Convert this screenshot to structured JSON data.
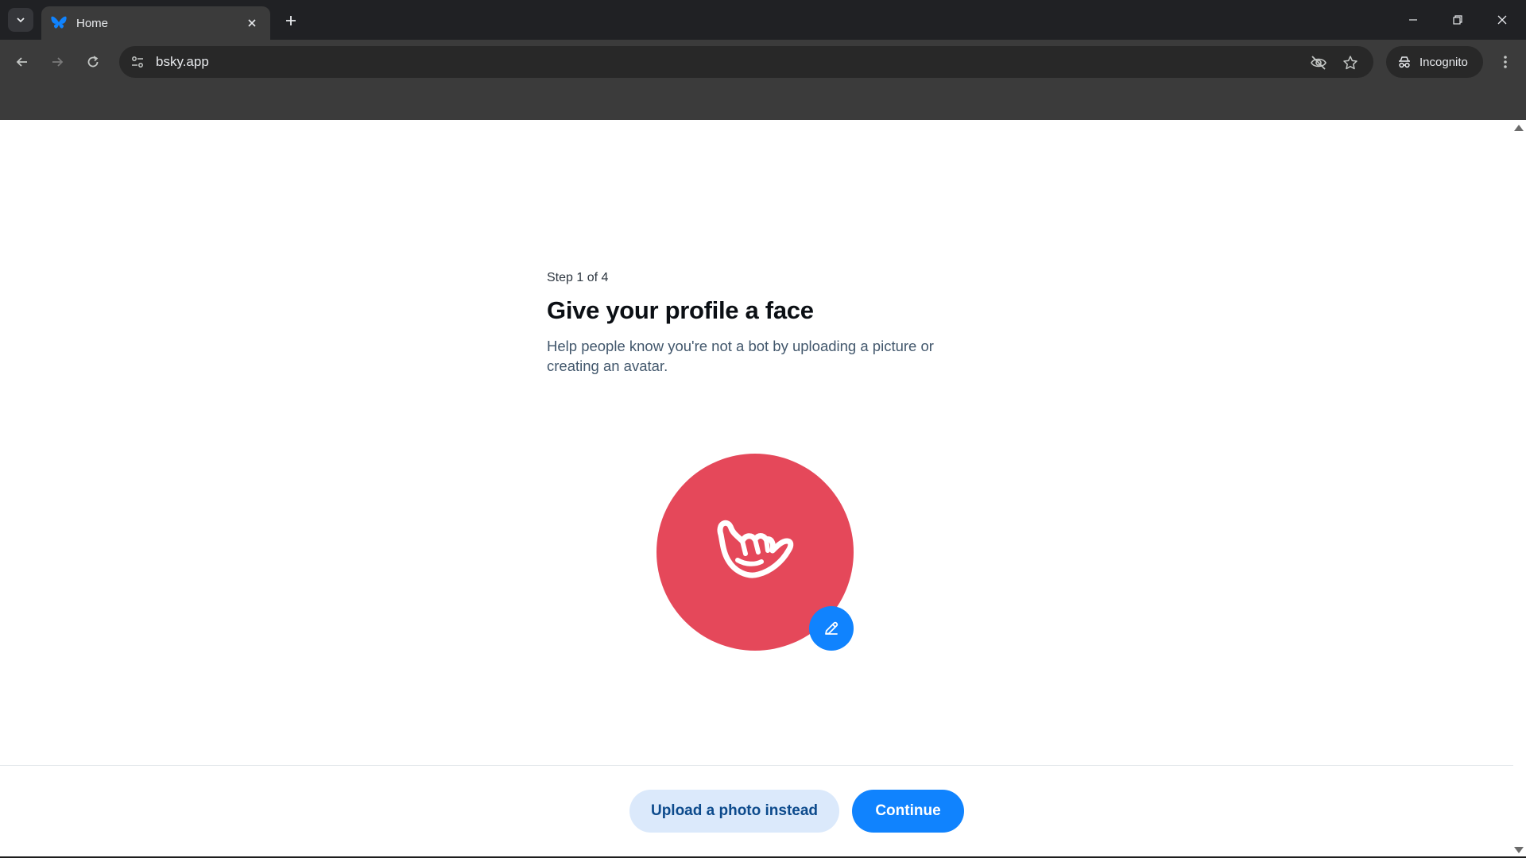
{
  "browser": {
    "tab": {
      "title": "Home",
      "favicon": "bluesky-butterfly-icon"
    },
    "address": {
      "url": "bsky.app"
    },
    "incognito_label": "Incognito"
  },
  "onboarding": {
    "step_label": "Step 1 of 4",
    "title": "Give your profile a face",
    "description": "Help people know you're not a bot by uploading a picture or creating an avatar.",
    "avatar": {
      "background": "#e5485a",
      "icon": "shaka-hand-icon"
    },
    "edit_button_icon": "pencil-icon"
  },
  "footer": {
    "upload_label": "Upload a photo instead",
    "continue_label": "Continue"
  },
  "colors": {
    "accent": "#1083fe",
    "avatar_bg": "#e5485a",
    "secondary_button_bg": "#dbe9fb"
  }
}
